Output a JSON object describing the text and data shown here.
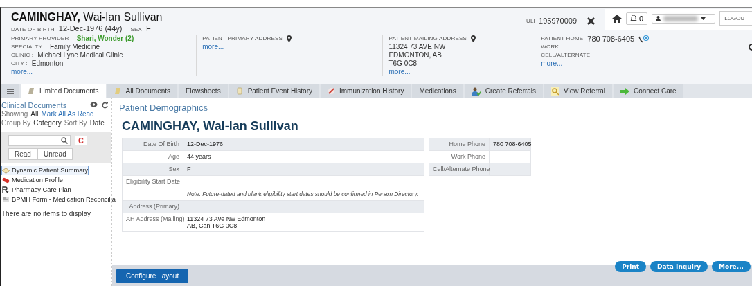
{
  "header": {
    "last_name": "CAMINGHAY,",
    "given_names": "Wai-lan Sullivan",
    "dob_label": "DATE OF BIRTH",
    "dob": "12-Dec-1976 (44y)",
    "sex_label": "SEX",
    "sex": "F",
    "uli_label": "ULI",
    "uli": "195970009"
  },
  "topbar": {
    "notifications": "0",
    "logout": "LOGOUT"
  },
  "info_columns": [
    {
      "fields": [
        {
          "label": "PRIMARY PROVIDER -",
          "value": "Shari, Wonder (2)",
          "kind": "provider"
        },
        {
          "label": "SPECIALTY :",
          "value": "Family Medicine",
          "kind": "plain"
        },
        {
          "label": "CLINIC :",
          "value": "Michael Lyne Medical Clinic",
          "kind": "plain"
        },
        {
          "label": "CITY :",
          "value": "Edmonton",
          "kind": "plain"
        }
      ],
      "more": "more..."
    },
    {
      "fields": [
        {
          "label": "PATIENT PRIMARY ADDRESS",
          "kind": "address"
        }
      ],
      "more": "more..."
    },
    {
      "fields": [
        {
          "label": "PATIENT MAILING ADDRESS",
          "kind": "address"
        }
      ],
      "lines": [
        "11324 73 AVE NW",
        "EDMONTON, AB",
        "T6G 0C8"
      ],
      "more": "more..."
    },
    {
      "fields": [
        {
          "label": "PATIENT HOME",
          "value": "780 708-6405",
          "kind": "phone"
        },
        {
          "label": "WORK",
          "kind": "plain"
        },
        {
          "label": "CELL/ALTERNATE",
          "kind": "plain"
        }
      ],
      "more": "more..."
    }
  ],
  "tabs": [
    {
      "label": "Limited Documents",
      "selected": true
    },
    {
      "label": "All Documents",
      "selected": false
    },
    {
      "label": "Flowsheets",
      "selected": false
    },
    {
      "label": "Patient Event History",
      "selected": false
    },
    {
      "label": "Immunization History",
      "selected": false
    },
    {
      "label": "Medications",
      "selected": false
    },
    {
      "label": "Create Referrals",
      "selected": false
    },
    {
      "label": "View Referral",
      "selected": false
    },
    {
      "label": "Connect Care",
      "selected": false
    }
  ],
  "sidebar": {
    "title": "Clinical Documents",
    "showing_label": "Showing",
    "showing_value": "All",
    "mark_all": "Mark All As Read",
    "group_label": "Group By",
    "group_value": "Category",
    "sort_label": "Sort By",
    "sort_value": "Date",
    "clear_button": "C",
    "filters": [
      "Read",
      "Unread"
    ],
    "documents": [
      {
        "label": "Dynamic Patient Summary",
        "selected": true
      },
      {
        "label": "Medication Profile",
        "selected": false
      },
      {
        "label": "Pharmacy Care Plan",
        "selected": false
      },
      {
        "label": "BPMH Form - Medication Reconcilia",
        "selected": false
      }
    ],
    "empty_message": "There are no items to display"
  },
  "main": {
    "section_title": "Patient Demographics",
    "patient_name": "CAMINGHAY, Wai-lan Sullivan",
    "demographics": [
      {
        "label": "Date Of Birth",
        "lines": [
          "12-Dec-1976"
        ],
        "shaded": true
      },
      {
        "label": "Age",
        "lines": [
          "44 years"
        ],
        "shaded": false
      },
      {
        "label": "Sex",
        "lines": [
          "F"
        ],
        "shaded": true
      },
      {
        "label": "Eligibility Start Date",
        "shaded": false
      },
      {
        "lines": [
          "Note: Future-dated and blank eligibility start dates should be confirmed in Person Directory."
        ],
        "kind": "note",
        "shaded": false
      },
      {
        "label": "Address (Primary)",
        "shaded": true
      },
      {
        "label": "AH Address (Mailing)",
        "lines": [
          "11324 73 Ave Nw Edmonton",
          "AB, Can T6G 0C8"
        ],
        "shaded": false
      }
    ],
    "phones": [
      {
        "label": "Home Phone",
        "lines": [
          "780 708-6405"
        ],
        "shaded": true
      },
      {
        "label": "Work Phone",
        "shaded": false
      },
      {
        "label": "Cell/Alternate Phone",
        "shaded": true
      }
    ],
    "actions": [
      "Print",
      "Data Inquiry",
      "More..."
    ],
    "configure_button": "Configure Layout"
  }
}
